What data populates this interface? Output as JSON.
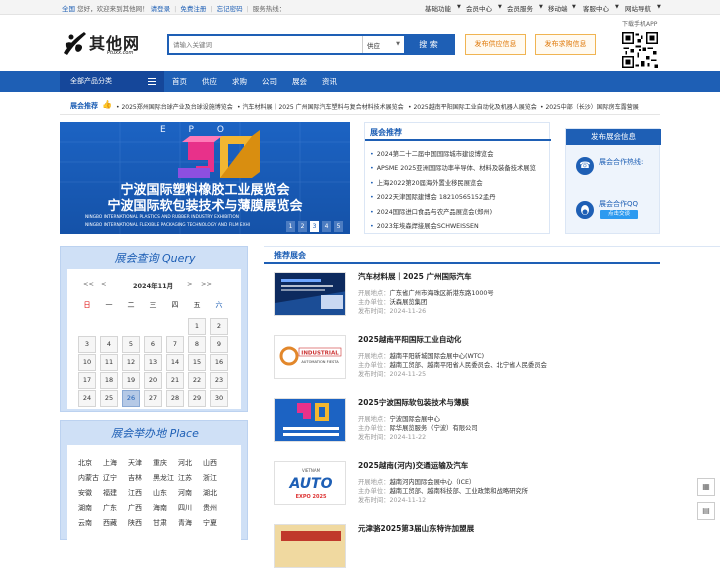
{
  "topbar": {
    "site": "全国",
    "welcome": "您好，欢迎来到其他网！",
    "login": "请登录",
    "register": "免费注册",
    "forgot": "忘记密码",
    "hotline": "服务热线：",
    "menus": [
      "基础功能",
      "会员中心",
      "会员服务",
      "移动端",
      "客服中心",
      "网站导航"
    ]
  },
  "logo": {
    "name": "其他网",
    "domain": "Ptuxx.com"
  },
  "search": {
    "placeholder": "请输入关键词",
    "type": "供应",
    "button": "搜 索"
  },
  "publish": {
    "supply": "发布供应信息",
    "demand": "发布求购信息"
  },
  "app": {
    "caption": "下载手机APP"
  },
  "nav": {
    "category": "全部产品分类",
    "items": [
      "首页",
      "供应",
      "求购",
      "公司",
      "展会",
      "资讯"
    ]
  },
  "ticker": {
    "label": "展会推荐",
    "items": [
      "2025郑州国际台球产业及台球设施博览会",
      "汽车材料展｜2025 广州国际汽车塑料与复合材料技术展览会",
      "2025越南平阳国际工业自动化及机器人展览会",
      "2025中部（长沙）国际房车露营展"
    ]
  },
  "banner": {
    "title1": "宁波国际塑料橡胶工业展览会",
    "title2": "宁波国际软包装技术与薄膜展览会",
    "en1": "NINGBO INTERNATIONAL PLASTICS AND RUBBER INDUSTRY EXHIBITION",
    "en2": "NINGBO INTERNATIONAL FLEXIBLE PACKAGING TECHNOLOGY AND FILM EXHI",
    "pages": [
      "1",
      "2",
      "3",
      "4",
      "5"
    ],
    "active_page": 3
  },
  "expo_box": {
    "title": "展会推荐",
    "items": [
      "2024第二十二届中国国际城市建设博览会",
      "APSME 2025亚洲国际功率半导体、材料及装备技术展览",
      "上海2022第20届海外置业移民展览会",
      "2022天津国际建博会 18210565152孟丹",
      "2024国际进口食品与农产品展览会(郑州)",
      "2023年埃森焊接展会SCHWEISSEN"
    ]
  },
  "service": {
    "publish": "发布展会信息",
    "hotline": "展会合作热线:",
    "qq": "展会合作QQ",
    "qq_button": "点击交谈"
  },
  "query": {
    "title": "展会查询 Query",
    "month": "2024年11月",
    "prev_year": "<<",
    "prev_month": "<",
    "next_month": ">",
    "next_year": ">>",
    "weekdays": [
      "日",
      "一",
      "二",
      "三",
      "四",
      "五",
      "六"
    ],
    "days": [
      "",
      "",
      "",
      "",
      "",
      "1",
      "2",
      "3",
      "4",
      "5",
      "6",
      "7",
      "8",
      "9",
      "10",
      "11",
      "12",
      "13",
      "14",
      "15",
      "16",
      "17",
      "18",
      "19",
      "20",
      "21",
      "22",
      "23",
      "24",
      "25",
      "26",
      "27",
      "28",
      "29",
      "30"
    ],
    "today": "26"
  },
  "place": {
    "title": "展会举办地 Place",
    "items": [
      "北京",
      "上海",
      "天津",
      "重庆",
      "河北",
      "山西",
      "内蒙古",
      "辽宁",
      "吉林",
      "黑龙江",
      "江苏",
      "浙江",
      "安徽",
      "福建",
      "江西",
      "山东",
      "河南",
      "湖北",
      "湖南",
      "广东",
      "广西",
      "海南",
      "四川",
      "贵州",
      "云南",
      "西藏",
      "陕西",
      "甘肃",
      "青海",
      "宁夏"
    ]
  },
  "recommend": {
    "title": "推荐展会",
    "labels": {
      "venue": "开展地点：",
      "organizer": "主办单位：",
      "time": "发布时间："
    },
    "items": [
      {
        "title": "汽车材料展｜2025 广州国际汽车",
        "venue": "广东省广州市海珠区新港东路1000号",
        "organizer": "沃森展览集团",
        "time": "2024-11-26",
        "thumb": "auto-material"
      },
      {
        "title": "2025越南平阳国际工业自动化",
        "venue": "越南平阳新城国际会展中心(WTC)",
        "organizer": "越南工贸部、越南平阳省人民委员会、北宁省人民委员会",
        "time": "2024-11-25",
        "thumb": "industrial-automation"
      },
      {
        "title": "2025宁波国际软包装技术与薄膜",
        "venue": "宁波国际会展中心",
        "organizer": "际华展览服务（宁波）有限公司",
        "time": "2024-11-22",
        "thumb": "ningbo-packaging"
      },
      {
        "title": "2025越南(河内)交通运输及汽车",
        "venue": "越南河内国际会展中心（ICE）",
        "organizer": "越南工贸部、越南科技部、工业政策和战略研究所",
        "time": "2024-11-12",
        "thumb": "vietnam-auto"
      },
      {
        "title": "元津骆2025第3届山东特许加盟展",
        "venue": "",
        "organizer": "",
        "time": "",
        "thumb": "shandong"
      }
    ],
    "thumb_text": {
      "industrial": "INDUSTRIAL",
      "automation": "AUTOMATION FIESTA",
      "vietnam": "VIETNAM",
      "auto": "AUTO",
      "expo": "EXPO 2025"
    }
  },
  "colors": {
    "brand": "#1e5fb5",
    "orange": "#e07a0a",
    "light": "#cfe0f6"
  }
}
